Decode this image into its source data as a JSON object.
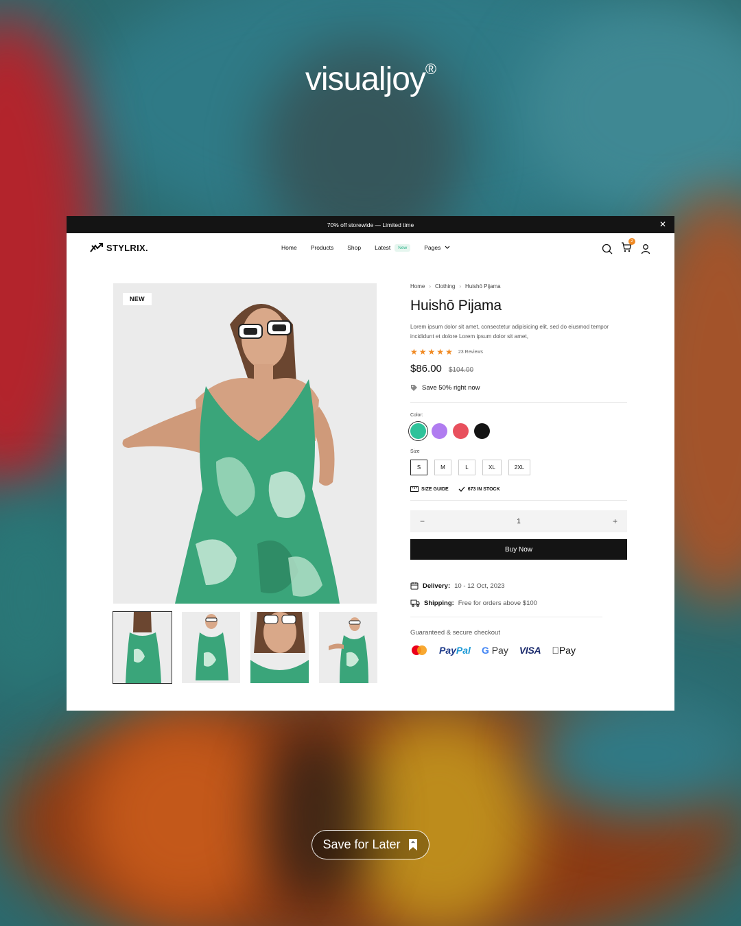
{
  "brand": {
    "name": "visualjoy",
    "mark": "®"
  },
  "promo": {
    "text": "70% off storewide — Limited time"
  },
  "nav": {
    "logo": "STYLRIX.",
    "items": [
      "Home",
      "Products",
      "Shop",
      "Latest",
      "Pages"
    ],
    "latest_badge": "New",
    "cart_count": "2"
  },
  "gallery": {
    "tag": "NEW"
  },
  "breadcrumb": [
    "Home",
    "Clothing",
    "Huishō Pijama"
  ],
  "product": {
    "title": "Huishō Pijama",
    "description": "Lorem ipsum dolor sit amet, consectetur adipisicing elit, sed do eiusmod tempor incididunt et dolore Lorem ipsum dolor sit amet,",
    "rating": 5,
    "reviews": "23 Reviews",
    "price": "$86.00",
    "old_price": "$104.00",
    "save_text": "Save 50% right now",
    "color_label": "Color:",
    "colors": [
      "#2ec29a",
      "#b07cf0",
      "#e8505d",
      "#141414"
    ],
    "size_label": "Size",
    "sizes": [
      "S",
      "M",
      "L",
      "XL",
      "2XL"
    ],
    "selected_size": "S",
    "size_guide": "SIZE GUIDE",
    "stock": "673 IN STOCK",
    "quantity": "1",
    "buy_label": "Buy Now",
    "delivery_label": "Delivery:",
    "delivery_value": "10 - 12 Oct, 2023",
    "shipping_label": "Shipping:",
    "shipping_value": "Free for orders above $100",
    "guarantee": "Guaranteed & secure checkout"
  },
  "payments": {
    "paypal_a": "Pay",
    "paypal_b": "Pal",
    "gpay": "Pay",
    "visa": "VISA",
    "apple": "Pay"
  },
  "cta": {
    "label": "Save for Later"
  },
  "colors": {
    "accent": "#f08a24",
    "dark": "#141414",
    "new_badge": "#2bb389"
  }
}
